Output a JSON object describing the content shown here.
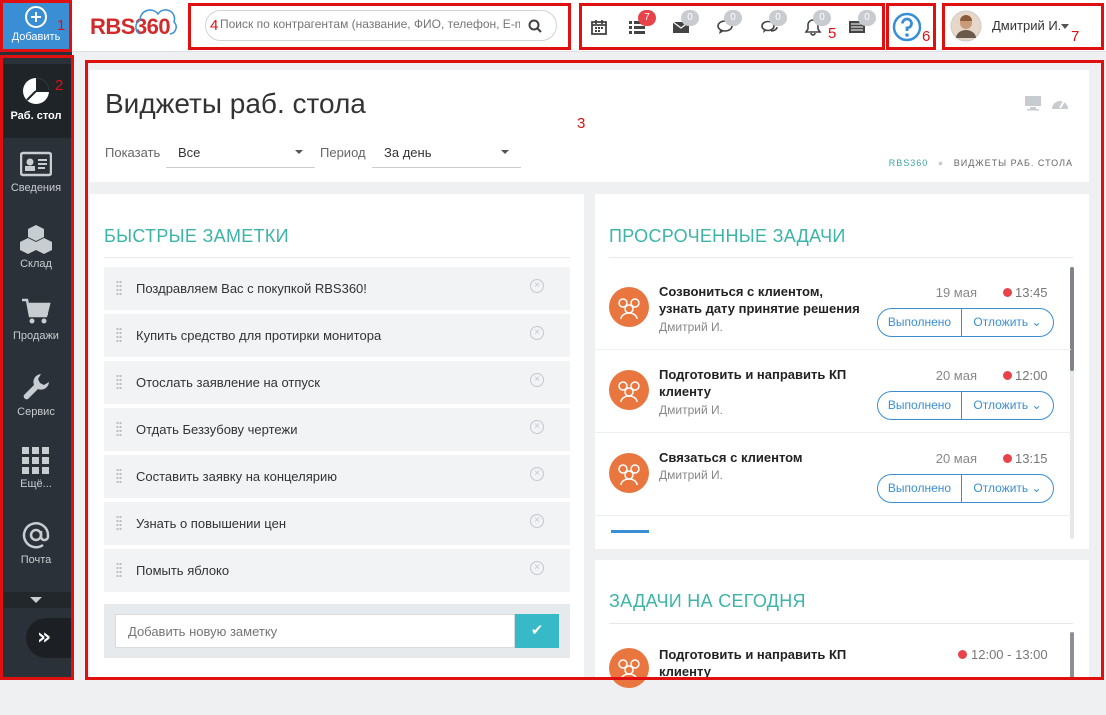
{
  "sidebar": {
    "add_label": "Добавить",
    "items": [
      {
        "label": "Раб. стол",
        "icon": "pie-chart-icon",
        "active": true
      },
      {
        "label": "Сведения",
        "icon": "id-card-icon"
      },
      {
        "label": "Склад",
        "icon": "boxes-icon"
      },
      {
        "label": "Продажи",
        "icon": "cart-icon"
      },
      {
        "label": "Сервис",
        "icon": "wrench-icon"
      },
      {
        "label": "Ещё...",
        "icon": "grid-icon"
      },
      {
        "label": "Почта",
        "icon": "at-icon"
      }
    ]
  },
  "header": {
    "logo": "RBS360",
    "search_placeholder": "Поиск по контрагентам (название, ФИО, телефон, E-mail)",
    "badges": {
      "tasks": "7",
      "mail": "0",
      "chat": "0",
      "comments": "0",
      "notifications": "0",
      "news": "0"
    },
    "user_name": "Дмитрий И."
  },
  "page": {
    "title": "Виджеты раб. стола",
    "show_label": "Показать",
    "show_value": "Все",
    "period_label": "Период",
    "period_value": "За день",
    "breadcrumb_home": "RBS360",
    "breadcrumb_current": "ВИДЖЕТЫ РАБ. СТОЛА"
  },
  "notes": {
    "title": "БЫСТРЫЕ ЗАМЕТКИ",
    "items": [
      "Поздравляем Вас с покупкой RBS360!",
      "Купить средство для протирки монитора",
      "Отослать заявление на отпуск",
      "Отдать Беззубову чертежи",
      "Составить заявку на концелярию",
      "Узнать о повышении цен",
      "Помыть яблоко"
    ],
    "add_placeholder": "Добавить новую заметку"
  },
  "overdue": {
    "title": "ПРОСРОЧЕННЫЕ ЗАДАЧИ",
    "done_label": "Выполнено",
    "postpone_label": "Отложить",
    "tasks": [
      {
        "title": "Созвониться с клиентом, узнать дату принятие решения",
        "user": "Дмитрий И.",
        "date": "19 мая",
        "time": "13:45"
      },
      {
        "title": "Подготовить и направить КП клиенту",
        "user": "Дмитрий И.",
        "date": "20 мая",
        "time": "12:00"
      },
      {
        "title": "Связаться с клиентом",
        "user": "Дмитрий И.",
        "date": "20 мая",
        "time": "13:15"
      }
    ]
  },
  "today": {
    "title": "ЗАДАЧИ НА СЕГОДНЯ",
    "tasks": [
      {
        "title": "Подготовить и направить КП клиенту",
        "time": "12:00 - 13:00"
      }
    ]
  },
  "annotations": [
    "1",
    "2",
    "3",
    "4",
    "5",
    "6",
    "7"
  ],
  "colors": {
    "accent": "#3a8fd4",
    "teal": "#3cb4a8",
    "sidebar": "#2b3138",
    "danger": "#e8434b",
    "avatar": "#e8763e"
  }
}
